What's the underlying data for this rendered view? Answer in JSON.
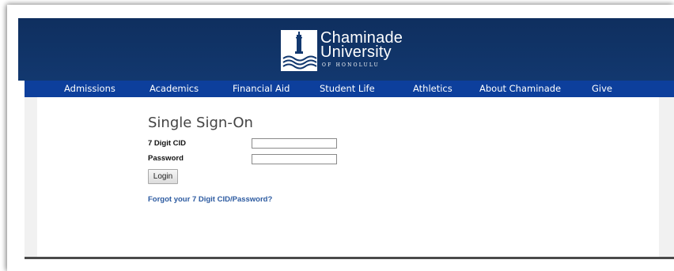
{
  "brand": {
    "name_line1": "Chaminade",
    "name_line2": "University",
    "name_line3": "OF HONOLULU",
    "logo_icon": "tower-waves-icon"
  },
  "nav": {
    "items": [
      {
        "label": "Admissions"
      },
      {
        "label": "Academics"
      },
      {
        "label": "Financial Aid"
      },
      {
        "label": "Student Life"
      },
      {
        "label": "Athletics"
      },
      {
        "label": "About Chaminade"
      },
      {
        "label": "Give"
      }
    ]
  },
  "login": {
    "title": "Single Sign-On",
    "cid_label": "7 Digit CID",
    "cid_value": "",
    "password_label": "Password",
    "password_value": "",
    "button_label": "Login",
    "forgot_link": "Forgot your 7 Digit CID/Password?"
  },
  "colors": {
    "header_bg": "#12386f",
    "nav_bg": "#0d3f9c",
    "link": "#2c5aa0"
  }
}
